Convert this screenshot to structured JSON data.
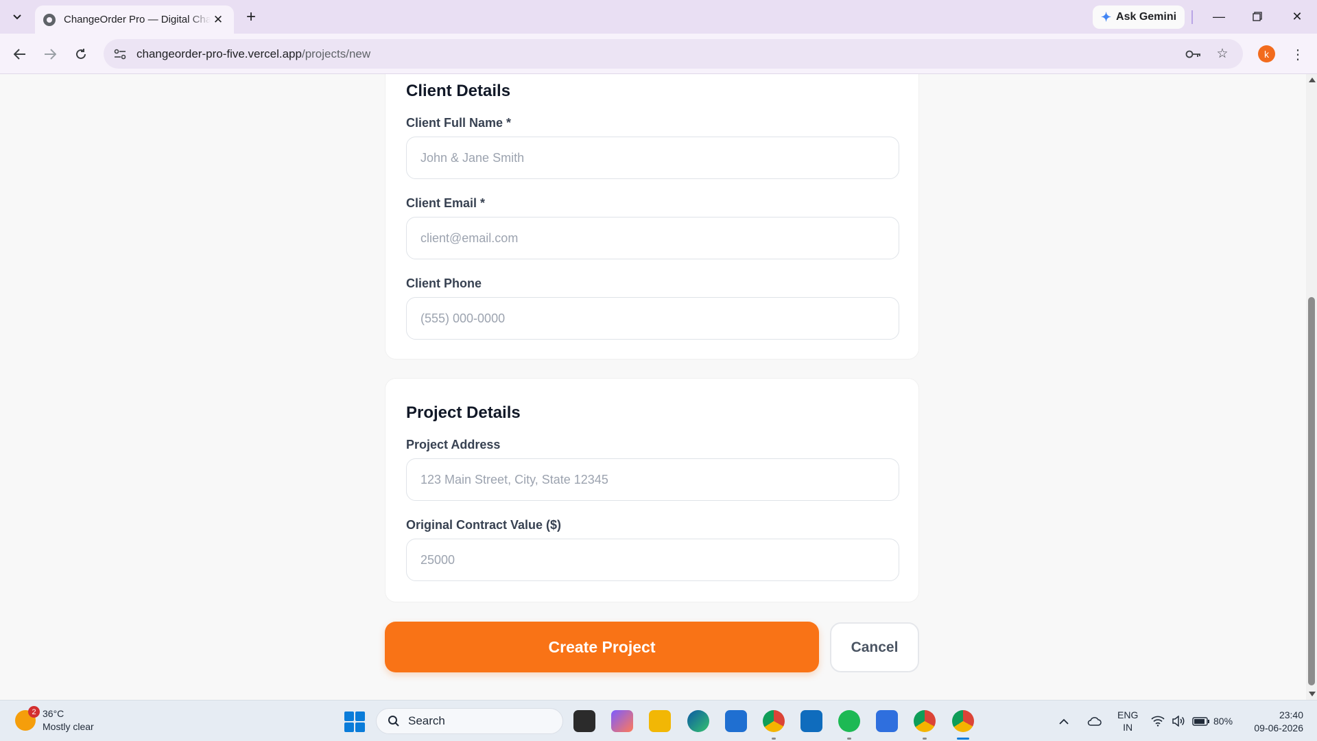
{
  "browser": {
    "tab_title": "ChangeOrder Pro — Digital Change Orders",
    "url_host": "changeorder-pro-five.vercel.app",
    "url_path": "/projects/new",
    "ask_gemini": "Ask Gemini",
    "profile_initial": "k"
  },
  "client_details": {
    "title": "Client Details",
    "name_label": "Client Full Name *",
    "name_placeholder": "John & Jane Smith",
    "email_label": "Client Email *",
    "email_placeholder": "client@email.com",
    "phone_label": "Client Phone",
    "phone_placeholder": "(555) 000-0000"
  },
  "project_details": {
    "title": "Project Details",
    "address_label": "Project Address",
    "address_placeholder": "123 Main Street, City, State 12345",
    "contract_label": "Original Contract Value ($)",
    "contract_placeholder": "25000"
  },
  "actions": {
    "create_label": "Create Project",
    "cancel_label": "Cancel"
  },
  "taskbar": {
    "weather_temp": "36°C",
    "weather_desc": "Mostly clear",
    "weather_badge": "2",
    "search_label": "Search",
    "lang_top": "ENG",
    "lang_bottom": "IN",
    "battery": "80%",
    "time": "23:40",
    "date": "09-06-2026"
  },
  "colors": {
    "accent": "#f97316",
    "tabbar": "#e9dff3"
  }
}
